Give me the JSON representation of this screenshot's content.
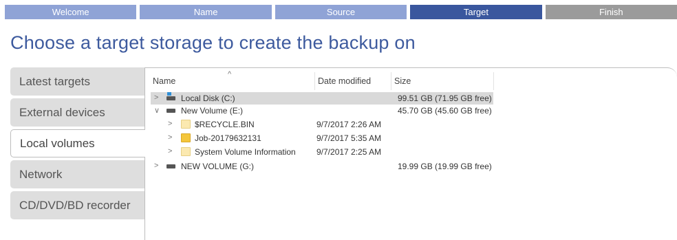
{
  "wizard": {
    "steps": [
      {
        "label": "Welcome",
        "state": "done"
      },
      {
        "label": "Name",
        "state": "done"
      },
      {
        "label": "Source",
        "state": "done"
      },
      {
        "label": "Target",
        "state": "active"
      },
      {
        "label": "Finish",
        "state": "todo"
      }
    ]
  },
  "page": {
    "title": "Choose a target storage to create the backup on"
  },
  "nav": {
    "items": [
      {
        "label": "Latest targets"
      },
      {
        "label": "External devices"
      },
      {
        "label": "Local volumes"
      },
      {
        "label": "Network"
      },
      {
        "label": "CD/DVD/BD recorder"
      }
    ],
    "selected": "Local volumes"
  },
  "table": {
    "columns": {
      "name": "Name",
      "date": "Date modified",
      "size": "Size"
    },
    "rows": [
      {
        "name": "Local Disk (C:)",
        "date": "",
        "size": "99.51 GB (71.95 GB free)",
        "icon": "system-drive-icon",
        "expanded": false,
        "selected": true
      },
      {
        "name": "New Volume (E:)",
        "date": "",
        "size": "45.70 GB (45.60 GB free)",
        "icon": "drive-icon",
        "expanded": true,
        "selected": false
      },
      {
        "name": "$RECYCLE.BIN",
        "date": "9/7/2017 2:26 AM",
        "size": "",
        "icon": "folder-icon",
        "expanded": false,
        "selected": false
      },
      {
        "name": "Job-20179632131",
        "date": "9/7/2017 5:35 AM",
        "size": "",
        "icon": "folder-icon",
        "expanded": false,
        "selected": false
      },
      {
        "name": "System Volume Information",
        "date": "9/7/2017 2:25 AM",
        "size": "",
        "icon": "folder-icon",
        "expanded": false,
        "selected": false
      },
      {
        "name": "NEW VOLUME (G:)",
        "date": "",
        "size": "19.99 GB (19.99 GB free)",
        "icon": "drive-icon",
        "expanded": false,
        "selected": false
      }
    ]
  },
  "colors": {
    "step_done": "#8fa3d6",
    "step_active": "#3a579e",
    "step_todo": "#9b9b9b",
    "title": "#3d5a9e"
  }
}
